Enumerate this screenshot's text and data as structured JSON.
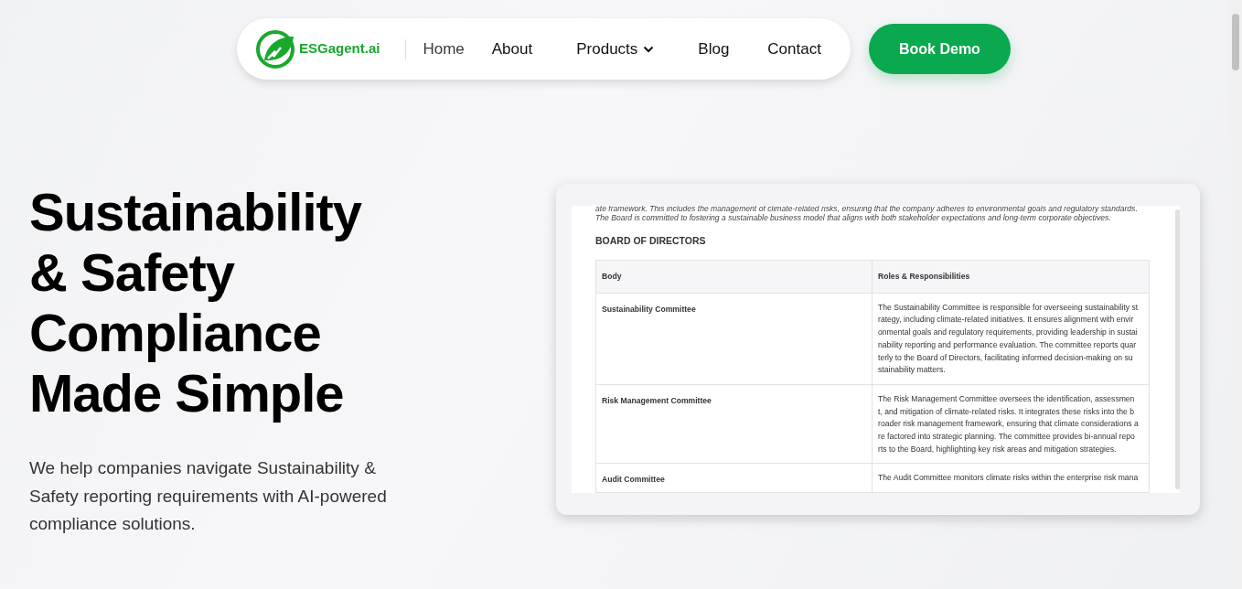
{
  "nav": {
    "logo": "ESGagent.ai",
    "items": [
      {
        "label": "Home",
        "selected": true,
        "kind": "link"
      },
      {
        "label": "About",
        "selected": false,
        "kind": "link"
      },
      {
        "label": "Products",
        "selected": false,
        "kind": "dropdown"
      },
      {
        "label": "Blog",
        "selected": false,
        "kind": "link"
      },
      {
        "label": "Contact",
        "selected": false,
        "kind": "link"
      }
    ],
    "cta": "Book Demo"
  },
  "hero": {
    "title": "Sustainability & Safety Compliance Made Simple",
    "subtitle": "We help companies navigate Sustainability & Safety reporting requirements with AI-powered compliance solutions."
  },
  "document": {
    "intro_lines": [
      "ate framework. This includes the management of climate-related risks, ensuring that the company adheres to environmental goals and regulatory standards.",
      "The Board is committed to fostering a sustainable business model that aligns with both stakeholder expectations and long-term corporate objectives."
    ],
    "heading": "BOARD OF DIRECTORS",
    "table": {
      "columns": [
        "Body",
        "Roles & Responsibilities"
      ],
      "rows": [
        {
          "body": "Sustainability Committee",
          "role_lines": [
            "The Sustainability Committee is responsible for overseeing sustainability st",
            "rategy, including climate-related initiatives. It ensures alignment with envir",
            "onmental goals and regulatory requirements, providing leadership in sustai",
            "nability reporting and performance evaluation. The committee reports quar",
            "terly to the Board of Directors, facilitating informed decision-making on su",
            "stainability matters."
          ]
        },
        {
          "body": "Risk Management Committee",
          "role_lines": [
            "The Risk Management Committee oversees the identification, assessmen",
            "t, and mitigation of climate-related risks. It integrates these risks into the b",
            "roader risk management framework, ensuring that climate considerations a",
            "re factored into strategic planning. The committee provides bi-annual repo",
            "rts to the Board, highlighting key risk areas and mitigation strategies."
          ]
        },
        {
          "body": "Audit Committee",
          "role_lines": [
            "The Audit Committee monitors climate risks within the enterprise risk mana"
          ]
        }
      ]
    }
  }
}
